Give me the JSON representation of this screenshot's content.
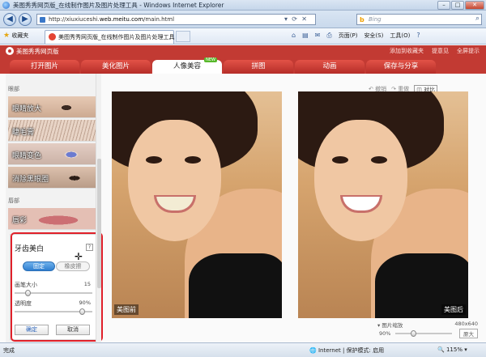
{
  "window": {
    "title": "美图秀秀网页版_在线制作图片及图片处理工具 - Windows Internet Explorer",
    "controls": [
      "–",
      "□",
      "✕"
    ]
  },
  "address": {
    "url_prefix": "http://xiuxiuceshi.",
    "url_domain": "web.meitu.com",
    "url_suffix": "/main.html",
    "search_placeholder": "Bing"
  },
  "favorites": {
    "label": "收藏夹",
    "tab_title": "美图秀秀网页版_在线制作图片及图片处理工具"
  },
  "commands": [
    "页面(P)",
    "安全(S)",
    "工具(O)"
  ],
  "app": {
    "name": "美图秀秀网页版",
    "links": [
      "添加到收藏夹",
      "提意见",
      "全屏提示"
    ],
    "tabs": [
      "打开图片",
      "美化图片",
      "人像美容",
      "拼图",
      "动画",
      "保存与分享"
    ],
    "active_tab": 2,
    "new_badge": "NEW"
  },
  "left_panel": {
    "section_eyes": "眼部",
    "items_eyes": [
      "眼睛放大",
      "睫毛膏",
      "眼睛变色",
      "消除黑眼圈"
    ],
    "section_lips": "唇部",
    "items_lips": [
      "唇彩"
    ]
  },
  "teeth_card": {
    "title": "牙齿美白",
    "help": "?",
    "mode_fix": "固定",
    "mode_eraser": "橡皮擦",
    "brush_label": "画笔大小",
    "brush_value": "15",
    "brush_fraction": 0.15,
    "opacity_label": "透明度",
    "opacity_value": "90%",
    "opacity_fraction": 0.9,
    "ok": "确定",
    "cancel": "取消"
  },
  "toolbar": {
    "undo": "撤销",
    "redo": "重做",
    "compare": "对比"
  },
  "photos": {
    "before_label": "美图前",
    "after_label": "美图后"
  },
  "zoom": {
    "title": "图片缩放",
    "size": "480x640",
    "percent": "90%",
    "original": "原大",
    "fraction": 0.3
  },
  "status": {
    "done": "完成",
    "zone": "Internet | 保护模式: 启用",
    "zoom": "115%"
  }
}
